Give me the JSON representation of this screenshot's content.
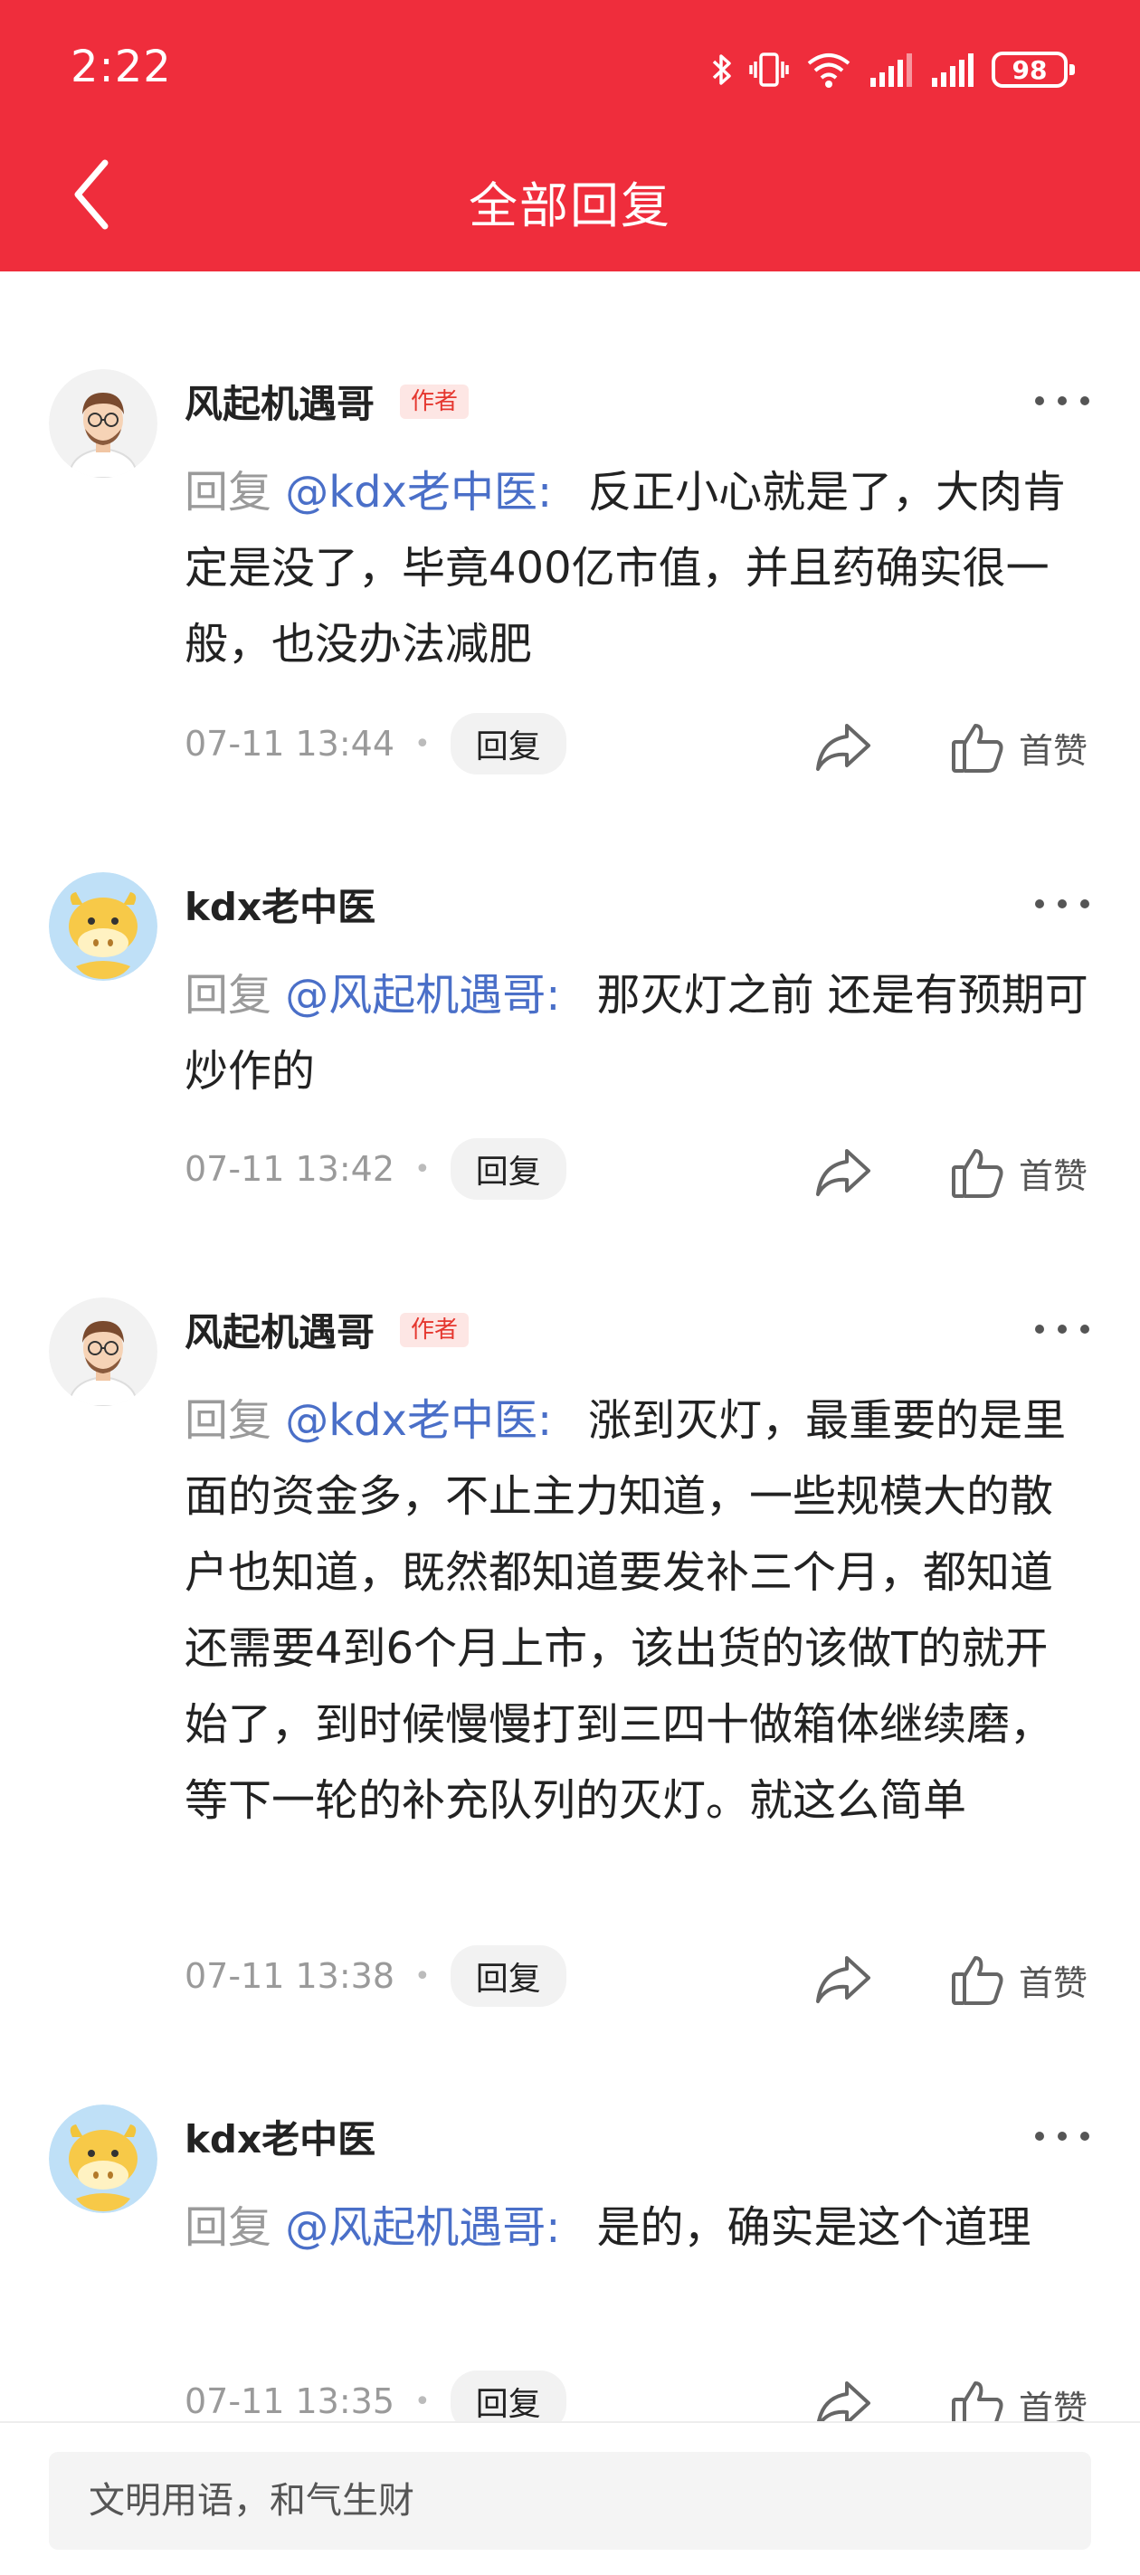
{
  "status": {
    "time": "2:22",
    "battery": "98"
  },
  "header": {
    "title": "全部回复"
  },
  "comments": [
    {
      "author": "风起机遇哥",
      "badge": "作者",
      "reply_prefix": "回复",
      "mention": "@kdx老中医:",
      "body": "反正小心就是了，大肉肯定是没了，毕竟400亿市值，并且药确实很一般，也没办法减肥",
      "time": "07-11 13:44",
      "reply_label": "回复",
      "like_label": "首赞",
      "avatar": "man-with-glasses-avatar"
    },
    {
      "author": "kdx老中医",
      "reply_prefix": "回复",
      "mention": "@风起机遇哥:",
      "body": "那灭灯之前 还是有预期可炒作的",
      "time": "07-11 13:42",
      "reply_label": "回复",
      "like_label": "首赞",
      "avatar": "cow-avatar"
    },
    {
      "author": "风起机遇哥",
      "badge": "作者",
      "reply_prefix": "回复",
      "mention": "@kdx老中医:",
      "body": "涨到灭灯，最重要的是里面的资金多，不止主力知道，一些规模大的散户也知道，既然都知道要发补三个月，都知道还需要4到6个月上市，该出货的该做T的就开始了，到时候慢慢打到三四十做箱体继续磨，等下一轮的补充队列的灭灯。就这么简单",
      "time": "07-11 13:38",
      "reply_label": "回复",
      "like_label": "首赞",
      "avatar": "man-with-glasses-avatar"
    },
    {
      "author": "kdx老中医",
      "reply_prefix": "回复",
      "mention": "@风起机遇哥:",
      "body": "是的，确实是这个道理",
      "time": "07-11 13:35",
      "reply_label": "回复",
      "like_label": "首赞",
      "avatar": "cow-avatar"
    }
  ],
  "composer": {
    "placeholder": "文明用语，和气生财"
  },
  "colors": {
    "header": "#ef2d3c",
    "mention": "#4a6fc8",
    "badge": "#e5372f"
  }
}
